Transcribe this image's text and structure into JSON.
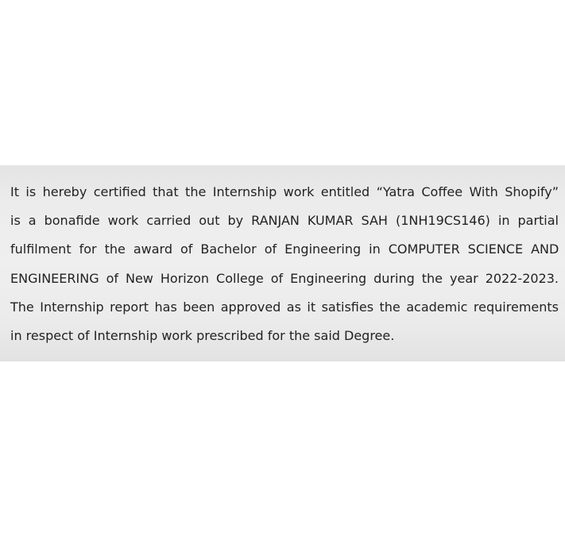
{
  "certificate": {
    "lines": [
      "It is hereby certified that the Internship work entitled “Yatra Coffee With Shopify”",
      "is a bonafide work carried out by RANJAN KUMAR SAH (1NH19CS146) in partial",
      "fulfilment for the award of Bachelor of Engineering in COMPUTER SCIENCE AND",
      "ENGINEERING of New Horizon College of Engineering during the year 2022-2023.",
      "The Internship report has been approved as it satisfies the academic requirements",
      "in respect of Internship work prescribed for the said Degree."
    ]
  }
}
